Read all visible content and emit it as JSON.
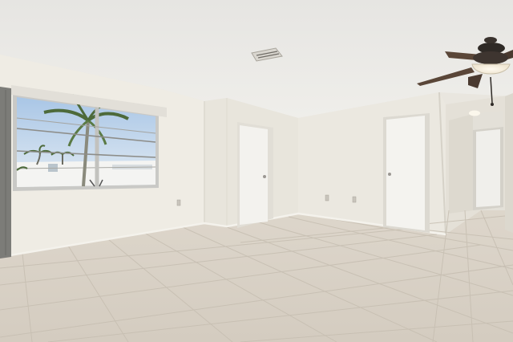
{
  "scene": {
    "subject": "empty-room-interior",
    "fixtures": [
      "ceiling",
      "air-vent",
      "ceiling-fan",
      "window",
      "palm-trees",
      "door-center",
      "door-right",
      "hallway",
      "hallway-door",
      "electrical-outlets",
      "tile-floor",
      "baseboard"
    ],
    "colors": {
      "ceiling": "#ecebe8",
      "wall_left": "#efece4",
      "wall_back": "#e9e6dd",
      "wall_right": "#ebe8e0",
      "door": "#f3f2ee",
      "floor": "#d8d1c6",
      "grout": "#c6beb1",
      "fan_blade": "#4a3a30",
      "window_frame": "#c9c9c6",
      "sky": "#c8dcef",
      "side_pane": "#7c7c78"
    }
  }
}
